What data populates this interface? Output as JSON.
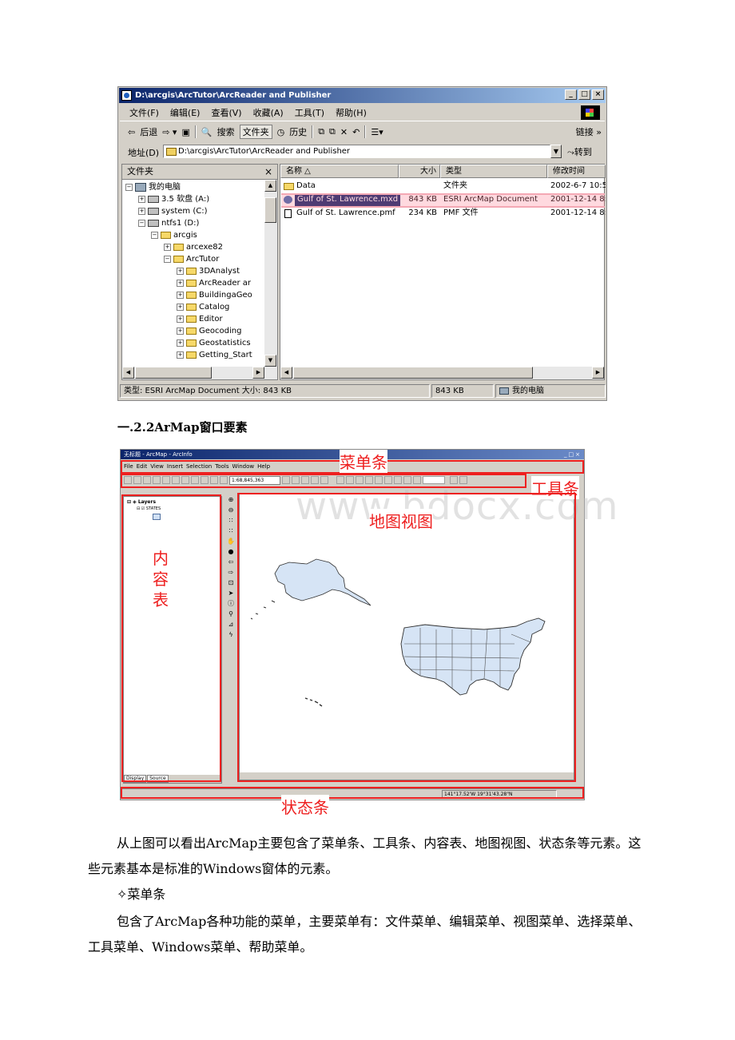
{
  "explorer": {
    "title": "D:\\arcgis\\ArcTutor\\ArcReader and Publisher",
    "menu": [
      "文件(F)",
      "编辑(E)",
      "查看(V)",
      "收藏(A)",
      "工具(T)",
      "帮助(H)"
    ],
    "toolbar": {
      "back": "后退",
      "search": "搜索",
      "folders": "文件夹",
      "history": "历史",
      "links": "链接 »"
    },
    "address": {
      "label": "地址(D)",
      "value": "D:\\arcgis\\ArcTutor\\ArcReader and Publisher",
      "go": "转到"
    },
    "folders_pane": {
      "title": "文件夹",
      "tree": [
        {
          "label": "我的电脑",
          "icon": "computer-icon"
        },
        {
          "label": "3.5 软盘 (A:)",
          "icon": "floppy-drive-icon"
        },
        {
          "label": "system (C:)",
          "icon": "hard-drive-icon"
        },
        {
          "label": "ntfs1 (D:)",
          "icon": "hard-drive-icon"
        },
        {
          "label": "arcgis",
          "icon": "folder-icon"
        },
        {
          "label": "arcexe82",
          "icon": "folder-icon"
        },
        {
          "label": "ArcTutor",
          "icon": "folder-icon"
        },
        {
          "label": "3DAnalyst",
          "icon": "folder-icon"
        },
        {
          "label": "ArcReader ar",
          "icon": "folder-icon"
        },
        {
          "label": "BuildingaGeo",
          "icon": "folder-icon"
        },
        {
          "label": "Catalog",
          "icon": "folder-icon"
        },
        {
          "label": "Editor",
          "icon": "folder-icon"
        },
        {
          "label": "Geocoding",
          "icon": "folder-icon"
        },
        {
          "label": "Geostatistics",
          "icon": "folder-icon"
        },
        {
          "label": "Getting_Start",
          "icon": "folder-icon"
        }
      ]
    },
    "columns": [
      "名称",
      "大小",
      "类型",
      "修改时间"
    ],
    "files": [
      {
        "name": "Data",
        "size": "",
        "type": "文件夹",
        "modified": "2002-6-7 10:5",
        "icon": "folder-icon"
      },
      {
        "name": "Gulf of St. Lawrence.mxd",
        "size": "843 KB",
        "type": "ESRI ArcMap Document",
        "modified": "2001-12-14 8:",
        "icon": "arcmap-document-icon"
      },
      {
        "name": "Gulf of St. Lawrence.pmf",
        "size": "234 KB",
        "type": "PMF 文件",
        "modified": "2001-12-14 8:",
        "icon": "pmf-file-icon"
      }
    ],
    "status": {
      "info": "类型: ESRI ArcMap Document 大小: 843 KB",
      "size": "843 KB",
      "location": "我的电脑"
    }
  },
  "doc": {
    "heading": "一.2.2ArMap窗口要素",
    "para1": "从上图可以看出ArcMap主要包含了菜单条、工具条、内容表、地图视图、状态条等元素。这些元素基本是标准的Windows窗体的元素。",
    "bullet": "✧菜单条",
    "para2": "包含了ArcMap各种功能的菜单，主要菜单有：文件菜单、编辑菜单、视图菜单、选择菜单、工具菜单、Windows菜单、帮助菜单。"
  },
  "arcmap": {
    "title": "无标题 - ArcMap - ArcInfo",
    "menu": [
      "File",
      "Edit",
      "View",
      "Insert",
      "Selection",
      "Tools",
      "Window",
      "Help"
    ],
    "scale": "1:68,845,363",
    "toc": {
      "layers_label": "Layers",
      "layer_name": "STATES",
      "tabs": [
        "Display",
        "Source"
      ]
    },
    "coordinates": "141°17.52'W 19°31'43.28\"N"
  },
  "annotations": {
    "menu_bar": "菜单条",
    "toolbar": "工具条",
    "map_view": "地图视图",
    "toc": "内容表",
    "status_bar": "状态条",
    "color": "#ee2020"
  },
  "watermark": "www.bdocx.com"
}
